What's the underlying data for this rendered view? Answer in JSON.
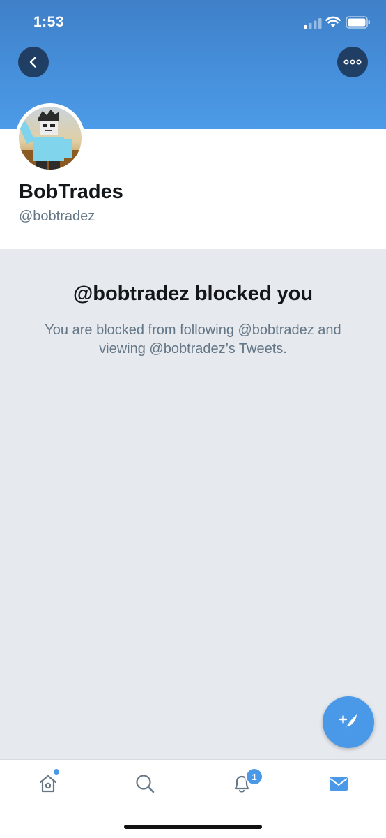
{
  "status_bar": {
    "time": "1:53"
  },
  "header": {
    "back_icon": "chevron-left-icon",
    "more_icon": "ellipsis-icon"
  },
  "profile": {
    "display_name": "BobTrades",
    "handle": "@bobtradez"
  },
  "blocked": {
    "title": "@bobtradez blocked you",
    "description": "You are blocked from following @bobtradez and viewing @bobtradez’s Tweets."
  },
  "compose": {
    "icon": "compose-tweet-icon"
  },
  "tab_bar": {
    "tabs": [
      {
        "name": "home",
        "icon": "home-icon"
      },
      {
        "name": "search",
        "icon": "search-icon"
      },
      {
        "name": "notifications",
        "icon": "bell-icon",
        "badge": "1"
      },
      {
        "name": "messages",
        "icon": "envelope-icon"
      }
    ]
  },
  "colors": {
    "accent": "#4a99e9",
    "background": "#e6e9ee",
    "text_primary": "#14171a",
    "text_secondary": "#657786"
  }
}
